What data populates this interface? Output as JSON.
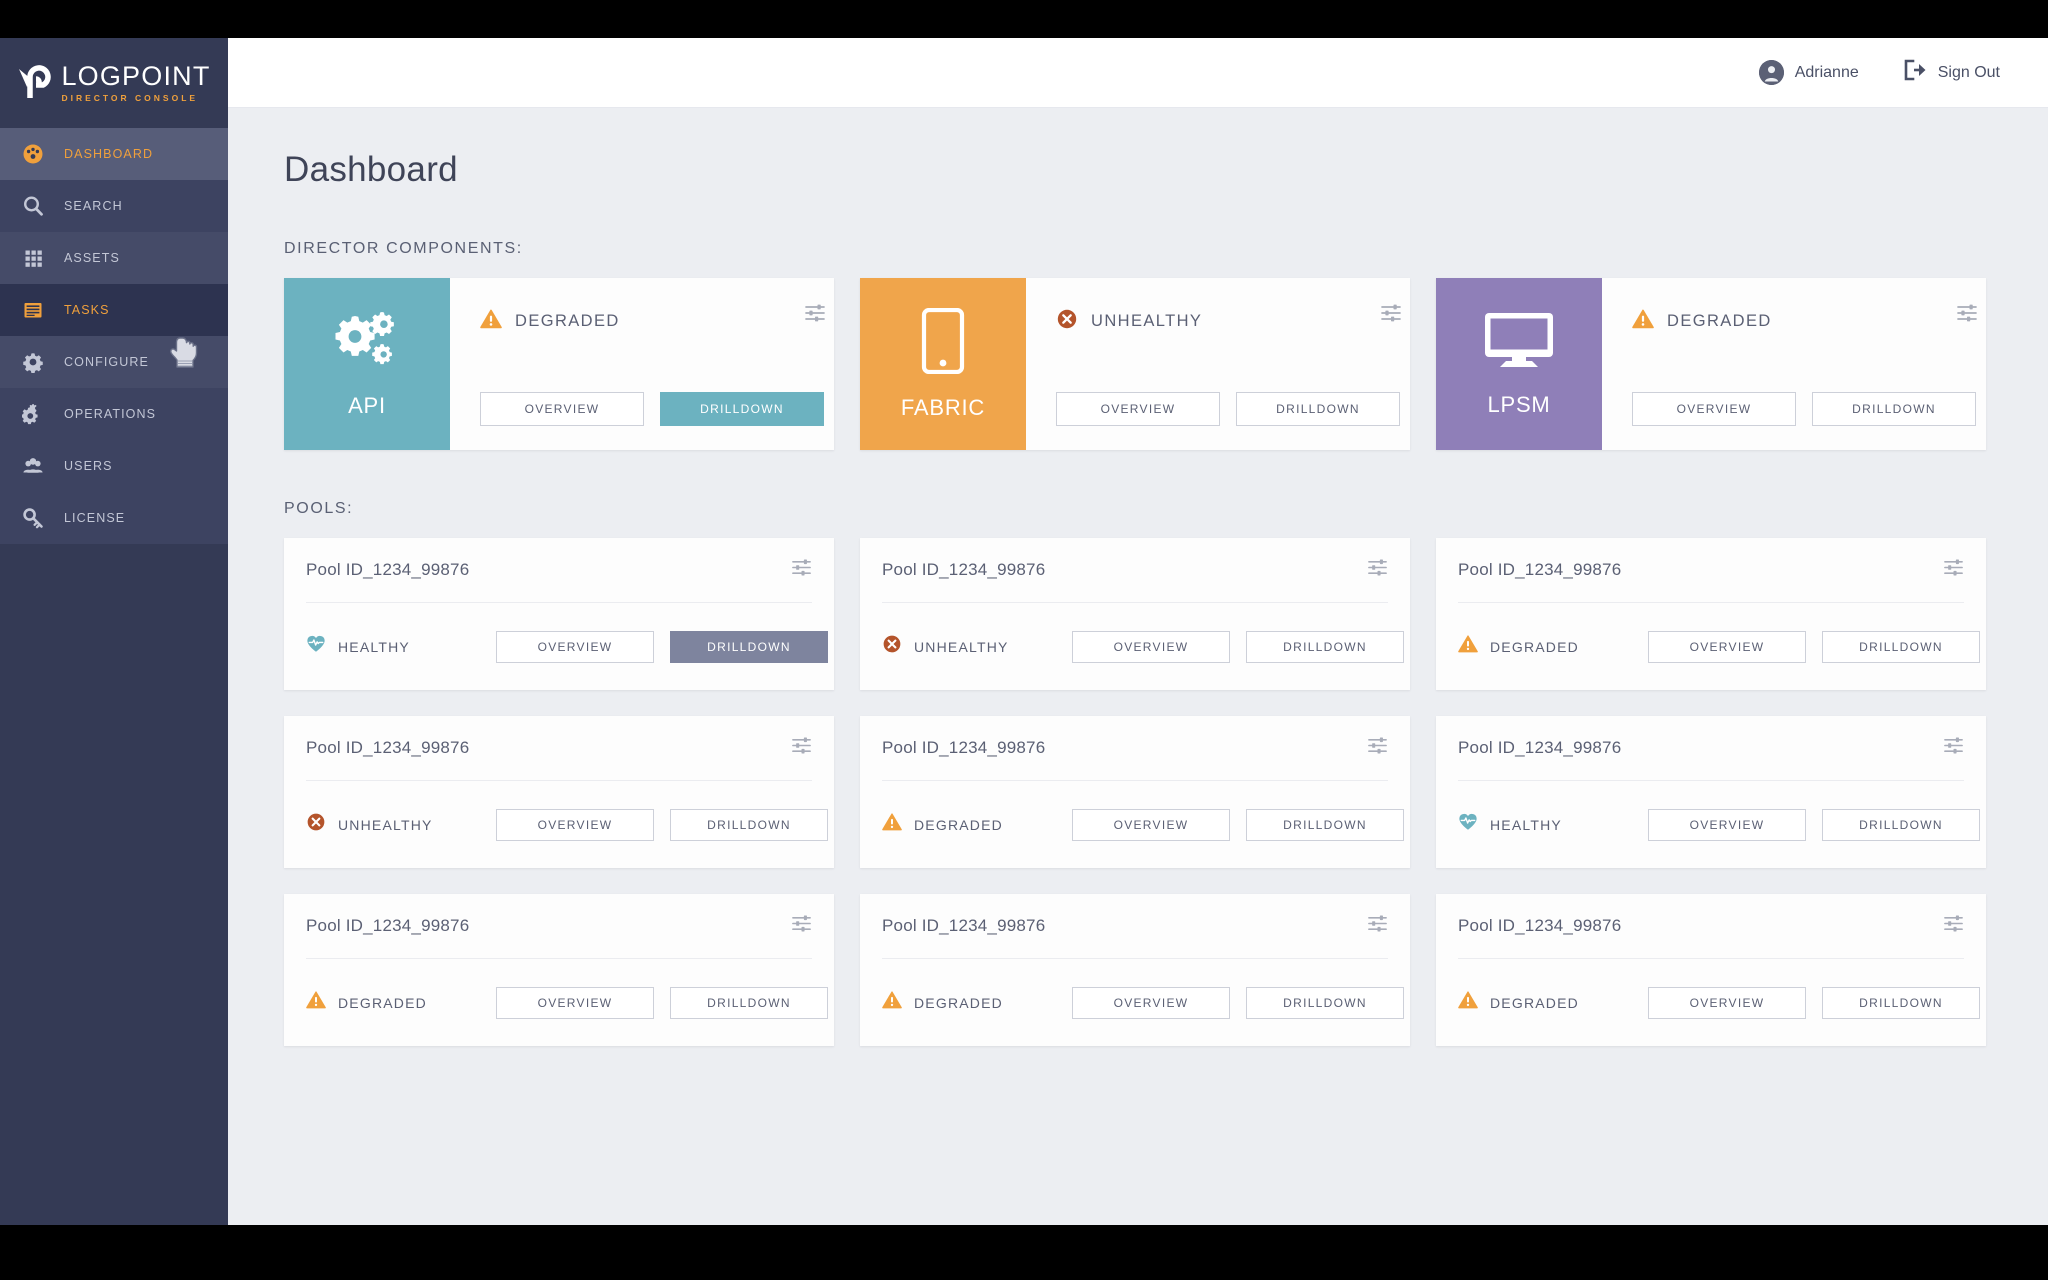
{
  "brand": {
    "title": "LOGPOINT",
    "subtitle": "DIRECTOR CONSOLE",
    "logo_icon": "logpoint-logo-icon"
  },
  "sidebar": {
    "items": [
      {
        "label": "DASHBOARD",
        "icon": "dashboard-gauge-icon",
        "state": "active-light"
      },
      {
        "label": "SEARCH",
        "icon": "search-magnifier-icon",
        "state": "default"
      },
      {
        "label": "ASSETS",
        "icon": "assets-grid-icon",
        "state": "alt"
      },
      {
        "label": "TASKS",
        "icon": "tasks-list-icon",
        "state": "active-dark"
      },
      {
        "label": "CONFIGURE",
        "icon": "gear-icon",
        "state": "alt"
      },
      {
        "label": "OPERATIONS",
        "icon": "gears-icon",
        "state": "default"
      },
      {
        "label": "USERS",
        "icon": "users-group-icon",
        "state": "default"
      },
      {
        "label": "LICENSE",
        "icon": "key-icon",
        "state": "default"
      }
    ]
  },
  "topbar": {
    "user_name": "Adrianne",
    "user_icon": "avatar-person-icon",
    "signout_label": "Sign Out",
    "signout_icon": "sign-out-icon"
  },
  "page": {
    "title": "Dashboard",
    "components_label": "DIRECTOR COMPONENTS:",
    "pools_label": "POOLS:"
  },
  "buttons": {
    "overview": "OVERVIEW",
    "drilldown": "DRILLDOWN"
  },
  "icons": {
    "settings": "sliders-settings-icon",
    "cursor": "hand-pointer-cursor"
  },
  "status_styles": {
    "HEALTHY": {
      "icon": "heart-pulse-icon",
      "color": "#6cb2c0"
    },
    "DEGRADED": {
      "icon": "warning-triangle-icon",
      "color": "#f0a03c"
    },
    "UNHEALTHY": {
      "icon": "error-circle-x-icon",
      "color": "#b4542b"
    }
  },
  "components": [
    {
      "name": "API",
      "icon": "gears-icon",
      "color": "#6cb2c0",
      "status": "DEGRADED",
      "drilldown_style": "filled-teal"
    },
    {
      "name": "FABRIC",
      "icon": "mobile-device-icon",
      "color": "#f0a54b",
      "status": "UNHEALTHY",
      "drilldown_style": "outline"
    },
    {
      "name": "LPSM",
      "icon": "desktop-monitor-icon",
      "color": "#8f7fb8",
      "status": "DEGRADED",
      "drilldown_style": "outline"
    }
  ],
  "pools": [
    {
      "title": "Pool ID_1234_99876",
      "status": "HEALTHY",
      "drilldown_style": "filled-slate"
    },
    {
      "title": "Pool ID_1234_99876",
      "status": "UNHEALTHY",
      "drilldown_style": "outline"
    },
    {
      "title": "Pool ID_1234_99876",
      "status": "DEGRADED",
      "drilldown_style": "outline"
    },
    {
      "title": "Pool ID_1234_99876",
      "status": "UNHEALTHY",
      "drilldown_style": "outline"
    },
    {
      "title": "Pool ID_1234_99876",
      "status": "DEGRADED",
      "drilldown_style": "outline"
    },
    {
      "title": "Pool ID_1234_99876",
      "status": "HEALTHY",
      "drilldown_style": "outline"
    },
    {
      "title": "Pool ID_1234_99876",
      "status": "DEGRADED",
      "drilldown_style": "outline"
    },
    {
      "title": "Pool ID_1234_99876",
      "status": "DEGRADED",
      "drilldown_style": "outline"
    },
    {
      "title": "Pool ID_1234_99876",
      "status": "DEGRADED",
      "drilldown_style": "outline"
    }
  ]
}
